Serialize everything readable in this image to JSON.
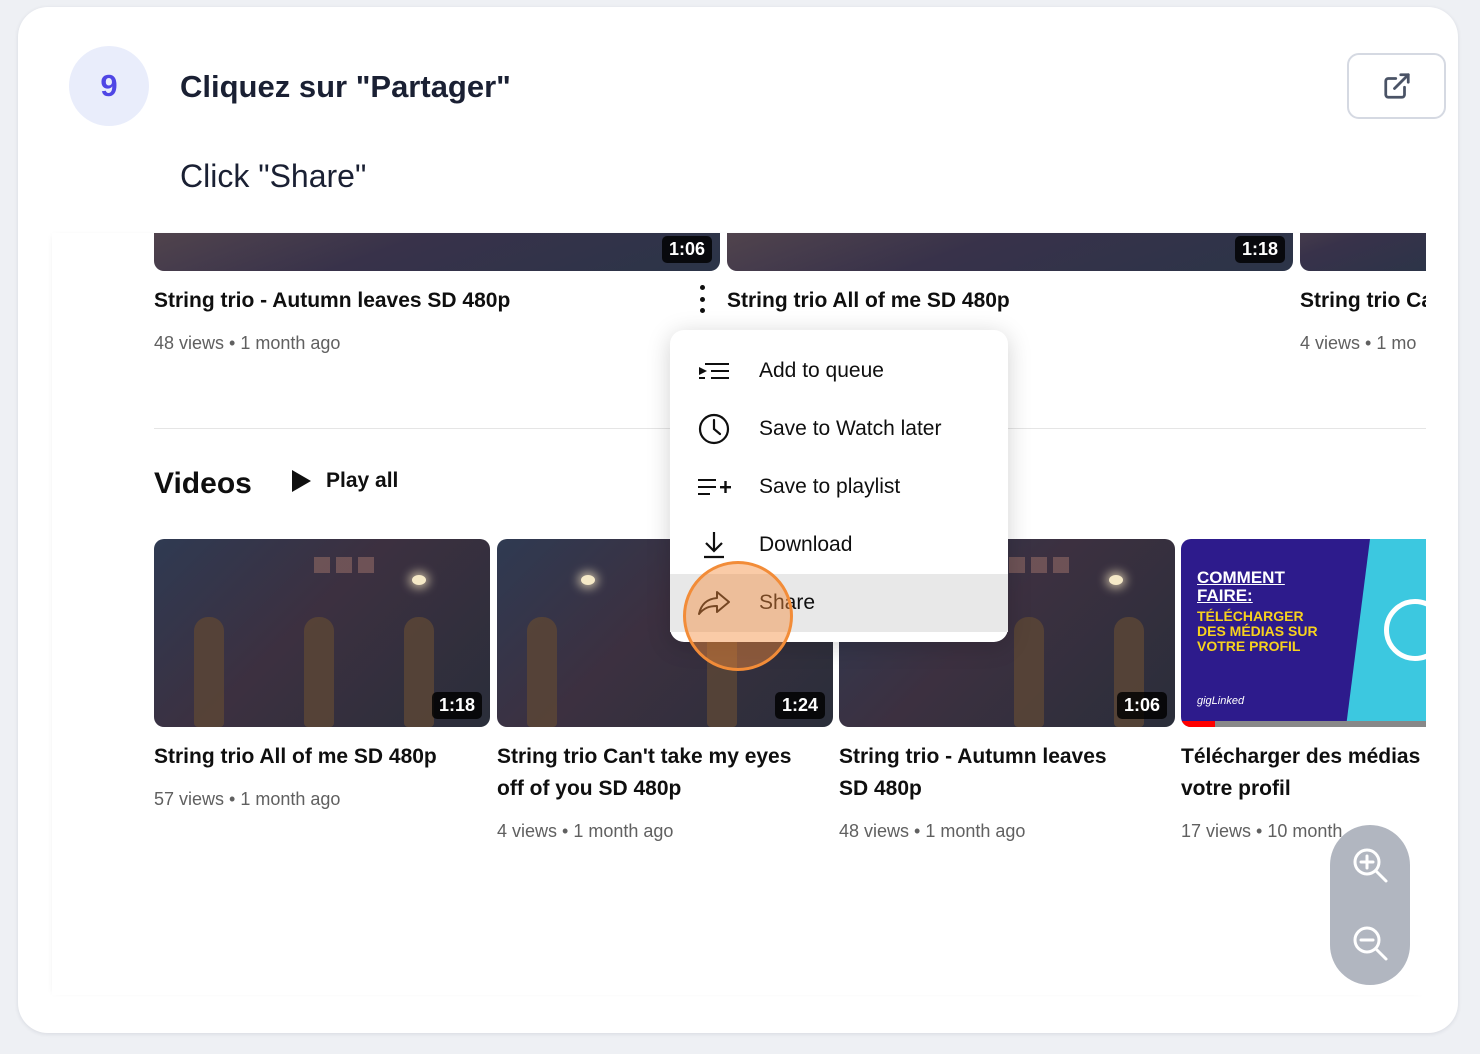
{
  "step": {
    "number": "9",
    "title": "Cliquez sur \"Partager\"",
    "subtitle": "Click \"Share\"",
    "open_icon": "external-link-icon"
  },
  "screenshot": {
    "top_row": [
      {
        "title": "String trio - Autumn leaves SD 480p",
        "meta": "48 views • 1 month ago",
        "duration": "1:06"
      },
      {
        "title": "String trio All of me SD 480p",
        "duration": "1:18"
      },
      {
        "title": "String trio Ca",
        "meta": "4 views • 1 mo"
      }
    ],
    "section": {
      "title": "Videos",
      "play_all": "Play all"
    },
    "videos": [
      {
        "title": "String trio All of me SD 480p",
        "meta": "57 views • 1 month ago",
        "duration": "1:18"
      },
      {
        "title_line1": "String trio Can't take my eyes",
        "title_line2": "off of you SD 480p",
        "meta": "4 views • 1 month ago",
        "duration": "1:24"
      },
      {
        "title_line1": "String trio - Autumn leaves",
        "title_line2": "SD 480p",
        "meta": "48 views • 1 month ago",
        "duration": "1:06"
      },
      {
        "title_line1": "Télécharger des médias",
        "title_line2": "votre profil",
        "meta": "17 views • 10 month",
        "promo_line1": "COMMENT",
        "promo_line2": "FAIRE:",
        "promo_line3": "TÉLÉCHARGER",
        "promo_line4": "DES MÉDIAS SUR",
        "promo_line5": "VOTRE PROFIL",
        "brand": "gigLinked",
        "progress": 0.14
      }
    ],
    "menu": [
      {
        "label": "Add to queue",
        "icon": "add-to-queue-icon"
      },
      {
        "label": "Save to Watch later",
        "icon": "clock-icon"
      },
      {
        "label": "Save to playlist",
        "icon": "playlist-add-icon"
      },
      {
        "label": "Download",
        "icon": "download-icon"
      },
      {
        "label": "Share",
        "icon": "share-icon",
        "active": true
      }
    ]
  },
  "colors": {
    "accent": "#4f46e5",
    "highlight": "#f28c38",
    "menu_active": "#e8e8e8"
  }
}
